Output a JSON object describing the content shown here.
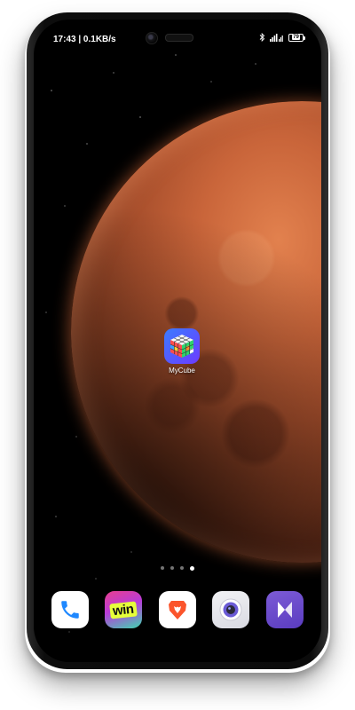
{
  "status_bar": {
    "time_and_speed": "17:43 | 0.1KB/s",
    "battery_level": "79",
    "icons": [
      "bluetooth-icon",
      "signal-icon",
      "battery-icon"
    ]
  },
  "home_screen": {
    "apps": [
      {
        "label": "MyCube",
        "icon": "rubiks-cube-icon"
      }
    ],
    "page_indicator": {
      "pages": 4,
      "active_index": 3
    }
  },
  "dock": {
    "apps": [
      {
        "icon": "phone-icon",
        "color": "#ffffff"
      },
      {
        "icon": "win-app-icon",
        "text": "win",
        "color": "#e83f8f"
      },
      {
        "icon": "brave-browser-icon",
        "color": "#fb542b"
      },
      {
        "icon": "camera-icon",
        "color": "#6b5bd6"
      },
      {
        "icon": "media-player-icon",
        "color": "#7c5bd6"
      }
    ]
  },
  "wallpaper": {
    "subject": "mars-planet",
    "colors": [
      "#c9653a",
      "#7e3a20",
      "#000000"
    ]
  }
}
